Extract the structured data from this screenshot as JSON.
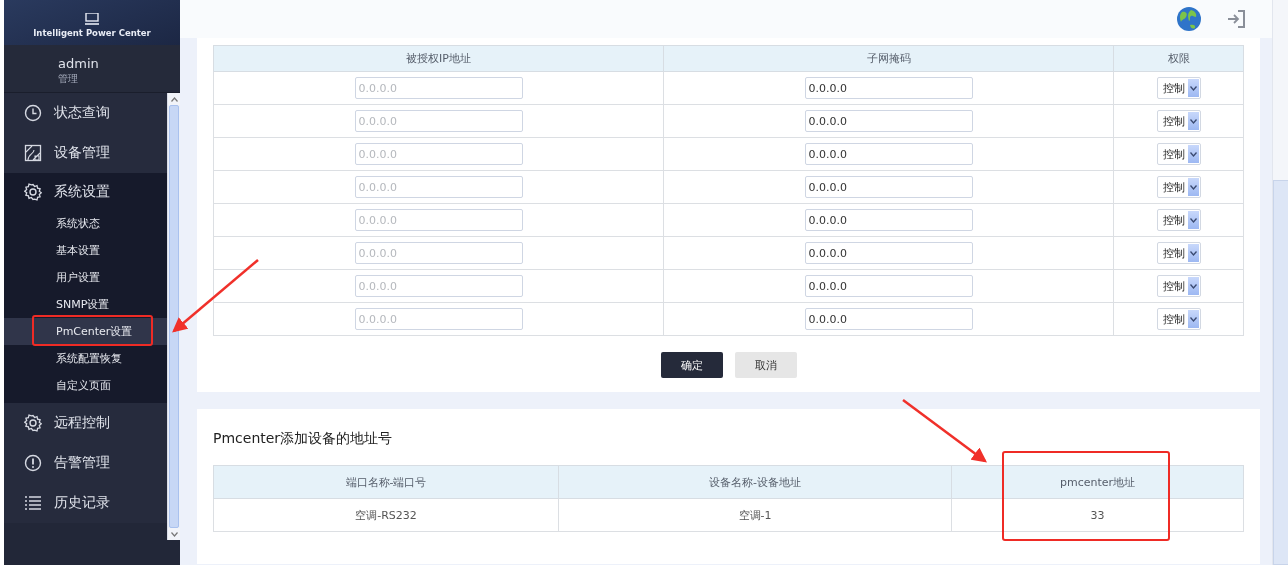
{
  "sidebar": {
    "logo_text": "Intelligent Power Center",
    "user": {
      "name": "admin",
      "role": "管理"
    },
    "menu": [
      {
        "label": "状态查询",
        "expanded": false
      },
      {
        "label": "设备管理",
        "expanded": false
      },
      {
        "label": "系统设置",
        "expanded": true,
        "children": [
          {
            "label": "系统状态",
            "selected": false
          },
          {
            "label": "基本设置",
            "selected": false
          },
          {
            "label": "用户设置",
            "selected": false
          },
          {
            "label": "SNMP设置",
            "selected": false
          },
          {
            "label": "PmCenter设置",
            "selected": true
          },
          {
            "label": "系统配置恢复",
            "selected": false
          },
          {
            "label": "自定义页面",
            "selected": false
          }
        ]
      },
      {
        "label": "远程控制",
        "expanded": false
      },
      {
        "label": "告警管理",
        "expanded": false
      },
      {
        "label": "历史记录",
        "expanded": false
      }
    ]
  },
  "acl_table": {
    "columns": [
      "被授权IP地址",
      "子网掩码",
      "权限"
    ],
    "rows": [
      {
        "ip_placeholder": "0.0.0.0",
        "mask": "0.0.0.0",
        "permission": "控制"
      },
      {
        "ip_placeholder": "0.0.0.0",
        "mask": "0.0.0.0",
        "permission": "控制"
      },
      {
        "ip_placeholder": "0.0.0.0",
        "mask": "0.0.0.0",
        "permission": "控制"
      },
      {
        "ip_placeholder": "0.0.0.0",
        "mask": "0.0.0.0",
        "permission": "控制"
      },
      {
        "ip_placeholder": "0.0.0.0",
        "mask": "0.0.0.0",
        "permission": "控制"
      },
      {
        "ip_placeholder": "0.0.0.0",
        "mask": "0.0.0.0",
        "permission": "控制"
      },
      {
        "ip_placeholder": "0.0.0.0",
        "mask": "0.0.0.0",
        "permission": "控制"
      },
      {
        "ip_placeholder": "0.0.0.0",
        "mask": "0.0.0.0",
        "permission": "控制"
      }
    ],
    "buttons": [
      {
        "label": "确定",
        "kind": "primary"
      },
      {
        "label": "取消",
        "kind": "secondary"
      }
    ]
  },
  "address_panel": {
    "title": "Pmcenter添加设备的地址号",
    "columns": [
      "端口名称-端口号",
      "设备名称-设备地址",
      "pmcenter地址"
    ],
    "rows": [
      [
        "空调-RS232",
        "空调-1",
        "33"
      ]
    ]
  }
}
